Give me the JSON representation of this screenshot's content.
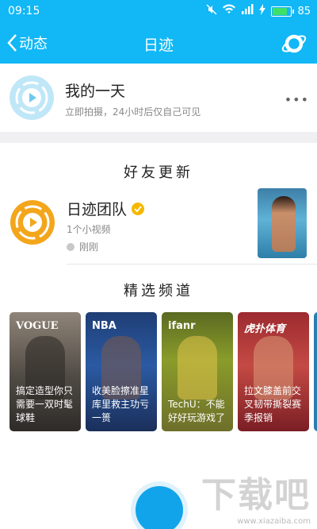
{
  "status_bar": {
    "time": "09:15",
    "battery": "85",
    "battery_level": 0.85
  },
  "nav": {
    "back_label": "动态",
    "title": "日迹"
  },
  "my_day": {
    "title": "我的一天",
    "subtitle": "立即拍摄，24小时后仅自己可见",
    "more": "•••"
  },
  "friends": {
    "section_title": "好友更新",
    "items": [
      {
        "name": "日迹团队",
        "count": "1个小视频",
        "time": "刚刚"
      }
    ]
  },
  "channels": {
    "section_title": "精选频道",
    "cards": [
      {
        "brand": "VOGUE",
        "text": "搞定造型你只需要一双时髦球鞋"
      },
      {
        "brand": "NBA",
        "text": "收美脸擦准星 库里救主功亏一篑"
      },
      {
        "brand": "ifanr",
        "text": "TechU：不能好好玩游戏了"
      },
      {
        "brand": "虎扑体育",
        "text": "拉文膝盖前交叉韧带撕裂赛季报销"
      },
      {
        "brand": "",
        "text": ""
      }
    ]
  },
  "watermark": {
    "big": "下载吧",
    "small": "www.xiazaiba.com"
  },
  "colors": {
    "brand_blue": "#12b7f5",
    "avatar_orange": "#f3a61c"
  }
}
